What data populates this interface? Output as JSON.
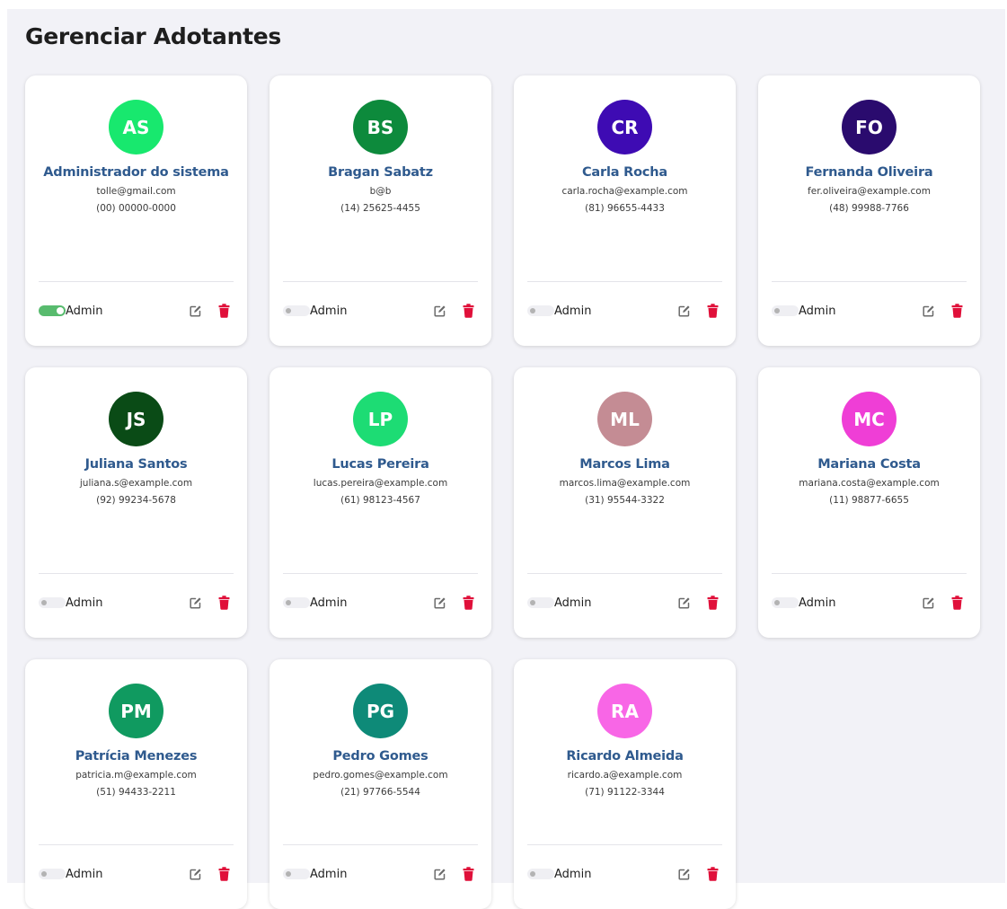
{
  "page": {
    "title": "Gerenciar Adotantes"
  },
  "users": [
    {
      "initials": "AS",
      "name": "Administrador do sistema",
      "email": "tolle@gmail.com",
      "phone": "(00) 00000-0000",
      "color": "#18e86e",
      "admin": true,
      "admin_label": "Admin"
    },
    {
      "initials": "BS",
      "name": "Bragan Sabatz",
      "email": "b@b",
      "phone": "(14) 25625-4455",
      "color": "#0d8a3c",
      "admin": false,
      "admin_label": "Admin"
    },
    {
      "initials": "CR",
      "name": "Carla Rocha",
      "email": "carla.rocha@example.com",
      "phone": "(81) 96655-4433",
      "color": "#3e0bb3",
      "admin": false,
      "admin_label": "Admin"
    },
    {
      "initials": "FO",
      "name": "Fernanda Oliveira",
      "email": "fer.oliveira@example.com",
      "phone": "(48) 99988-7766",
      "color": "#2a0b6e",
      "admin": false,
      "admin_label": "Admin"
    },
    {
      "initials": "JS",
      "name": "Juliana Santos",
      "email": "juliana.s@example.com",
      "phone": "(92) 99234-5678",
      "color": "#0a4b16",
      "admin": false,
      "admin_label": "Admin"
    },
    {
      "initials": "LP",
      "name": "Lucas Pereira",
      "email": "lucas.pereira@example.com",
      "phone": "(61) 98123-4567",
      "color": "#1ddc74",
      "admin": false,
      "admin_label": "Admin"
    },
    {
      "initials": "ML",
      "name": "Marcos Lima",
      "email": "marcos.lima@example.com",
      "phone": "(31) 95544-3322",
      "color": "#c48c94",
      "admin": false,
      "admin_label": "Admin"
    },
    {
      "initials": "MC",
      "name": "Mariana Costa",
      "email": "mariana.costa@example.com",
      "phone": "(11) 98877-6655",
      "color": "#ef3ed6",
      "admin": false,
      "admin_label": "Admin"
    },
    {
      "initials": "PM",
      "name": "Patrícia Menezes",
      "email": "patricia.m@example.com",
      "phone": "(51) 94433-2211",
      "color": "#109a60",
      "admin": false,
      "admin_label": "Admin"
    },
    {
      "initials": "PG",
      "name": "Pedro Gomes",
      "email": "pedro.gomes@example.com",
      "phone": "(21) 97766-5544",
      "color": "#0e8a78",
      "admin": false,
      "admin_label": "Admin"
    },
    {
      "initials": "RA",
      "name": "Ricardo Almeida",
      "email": "ricardo.a@example.com",
      "phone": "(71) 91122-3344",
      "color": "#f866e6",
      "admin": false,
      "admin_label": "Admin"
    }
  ],
  "icons": {
    "edit": "edit-icon",
    "delete": "trash-icon"
  },
  "colors": {
    "name": "#2f5a8e",
    "toggle_on": "#58bb6e",
    "delete": "#e0103a",
    "edit": "#6b6b6b"
  }
}
